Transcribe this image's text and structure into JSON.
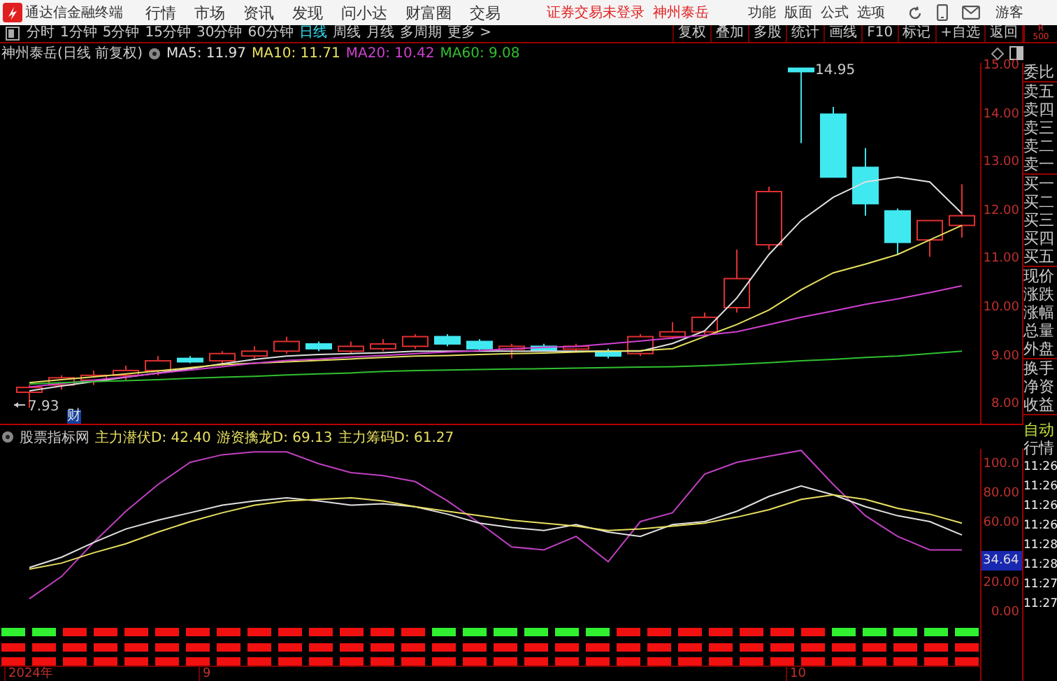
{
  "menu_bar": {
    "app_title": "通达信金融终端",
    "menus": [
      "行情",
      "市场",
      "资讯",
      "发现",
      "问小达",
      "财富圈",
      "交易"
    ],
    "login_status": "证券交易未登录",
    "stock_name": "神州泰岳",
    "tools": [
      "功能",
      "版面",
      "公式",
      "选项"
    ],
    "user": "游客"
  },
  "period_tabs": [
    {
      "label": "分时",
      "selected": false
    },
    {
      "label": "1分钟",
      "selected": false
    },
    {
      "label": "5分钟",
      "selected": false
    },
    {
      "label": "15分钟",
      "selected": false
    },
    {
      "label": "30分钟",
      "selected": false
    },
    {
      "label": "60分钟",
      "selected": false
    },
    {
      "label": "日线",
      "selected": true
    },
    {
      "label": "周线",
      "selected": false
    },
    {
      "label": "月线",
      "selected": false
    },
    {
      "label": "多周期",
      "selected": false
    },
    {
      "label": "更多 >",
      "selected": false
    }
  ],
  "tool_buttons": [
    "复权",
    "叠加",
    "多股",
    "统计",
    "画线",
    "F10",
    "标记",
    "+自选",
    "返回"
  ],
  "panel_header": {
    "line_1": "R",
    "line_2": "500"
  },
  "chart_title": "神州泰岳(日线 前复权)",
  "moving_averages": [
    {
      "label": "MA5: 11.97",
      "color": "#e0e0e0"
    },
    {
      "label": "MA10: 11.71",
      "color": "#e8e060"
    },
    {
      "label": "MA20: 10.42",
      "color": "#d040d0"
    },
    {
      "label": "MA60: 9.08",
      "color": "#30c030"
    }
  ],
  "price_chart": {
    "chart_data": {
      "type": "line",
      "ylim": [
        7.6,
        15.06
      ],
      "yticks": [
        {
          "value": 15,
          "label": "15.00"
        },
        {
          "value": 14,
          "label": "14.00"
        },
        {
          "value": 13,
          "label": "13.00"
        },
        {
          "value": 12,
          "label": "12.00"
        },
        {
          "value": 11,
          "label": "11.00"
        },
        {
          "value": 10,
          "label": "10.00"
        },
        {
          "value": 9,
          "label": "9.00"
        },
        {
          "value": 8,
          "label": "8.00"
        }
      ],
      "series": [
        {
          "color": "#e0e0e0",
          "values": [
            8.28,
            8.38,
            8.47,
            8.56,
            8.65,
            8.74,
            8.84,
            8.93,
            9.0,
            9.03,
            9.05,
            9.07,
            9.1,
            9.1,
            9.1,
            9.1,
            9.1,
            9.1,
            9.1,
            9.1,
            9.26,
            9.52,
            10.2,
            11.1,
            11.8,
            12.28,
            12.6,
            12.7,
            12.6,
            11.95
          ]
        },
        {
          "color": "#e8e060",
          "values": [
            8.45,
            8.51,
            8.57,
            8.63,
            8.69,
            8.76,
            8.82,
            8.85,
            8.88,
            8.91,
            8.94,
            8.97,
            9.0,
            9.01,
            9.03,
            9.05,
            9.06,
            9.08,
            9.1,
            9.11,
            9.15,
            9.4,
            9.65,
            9.95,
            10.37,
            10.72,
            10.9,
            11.1,
            11.4,
            11.7
          ]
        },
        {
          "color": "#d040d0",
          "values": [
            8.36,
            8.43,
            8.5,
            8.57,
            8.64,
            8.71,
            8.78,
            8.85,
            8.91,
            8.94,
            8.98,
            9.01,
            9.05,
            9.08,
            9.11,
            9.15,
            9.18,
            9.2,
            9.25,
            9.31,
            9.37,
            9.43,
            9.5,
            9.65,
            9.8,
            9.93,
            10.07,
            10.18,
            10.31,
            10.45
          ]
        },
        {
          "color": "#30c030",
          "values": [
            8.42,
            8.45,
            8.47,
            8.49,
            8.51,
            8.54,
            8.56,
            8.58,
            8.61,
            8.63,
            8.65,
            8.68,
            8.7,
            8.71,
            8.72,
            8.73,
            8.74,
            8.75,
            8.76,
            8.77,
            8.78,
            8.8,
            8.83,
            8.86,
            8.9,
            8.93,
            8.97,
            9.0,
            9.05,
            9.1
          ]
        }
      ]
    }
  },
  "price_marks": {
    "high": "14.95",
    "low": "7.93",
    "event_marker": "财"
  },
  "indicator": {
    "source": "股票指标网",
    "values": [
      "主力潜伏D: 42.40",
      "游资擒龙D: 69.13",
      "主力筹码D: 61.27"
    ],
    "current_value": "34.64",
    "chart_data": {
      "type": "line",
      "ylim": [
        -36,
        110
      ],
      "yticks": [
        {
          "value": 100,
          "label": "100.0"
        },
        {
          "value": 80,
          "label": "80.00"
        },
        {
          "value": 60,
          "label": "60.00"
        },
        {
          "value": 20,
          "label": "20.00"
        },
        {
          "value": 0,
          "label": "0.00"
        }
      ],
      "series": [
        {
          "color": "#c040c0",
          "values": [
            9,
            24,
            47,
            68,
            86,
            101,
            106,
            108,
            108,
            100,
            94,
            92,
            88,
            75,
            60,
            44,
            42,
            51,
            34,
            61,
            67,
            93,
            101,
            105,
            109,
            86,
            65,
            51,
            42,
            42
          ]
        },
        {
          "color": "#e0e0e0",
          "values": [
            30,
            37,
            47,
            56,
            62,
            67,
            72,
            75,
            77,
            75,
            72,
            73,
            71,
            66,
            60,
            57,
            55,
            59,
            54,
            51,
            59,
            61,
            68,
            78,
            85,
            79,
            71,
            65,
            61,
            52
          ]
        },
        {
          "color": "#e8e060",
          "values": [
            29,
            33,
            40,
            46,
            54,
            61,
            67,
            72,
            75,
            76,
            77,
            75,
            71,
            68,
            65,
            62,
            60,
            58,
            55,
            56,
            58,
            60,
            64,
            69,
            76,
            79,
            76,
            70,
            66,
            60
          ]
        }
      ]
    }
  },
  "date_axis": [
    "2024年",
    "9",
    "10"
  ],
  "right_panel": {
    "groups": [
      [
        "委比"
      ],
      [
        "卖五",
        "卖四",
        "卖三",
        "卖二",
        "卖一"
      ],
      [
        "买一",
        "买二",
        "买三",
        "买四",
        "买五"
      ],
      [
        "现价",
        "涨跌",
        "涨幅",
        "总量",
        "外盘"
      ],
      [
        "换手",
        "净资",
        "收益"
      ]
    ],
    "mode": "自动",
    "section": "行情",
    "times": [
      "11:26",
      "11:26",
      "11:26",
      "11:26",
      "11:28",
      "11:28",
      "11:27",
      "11:27"
    ]
  }
}
